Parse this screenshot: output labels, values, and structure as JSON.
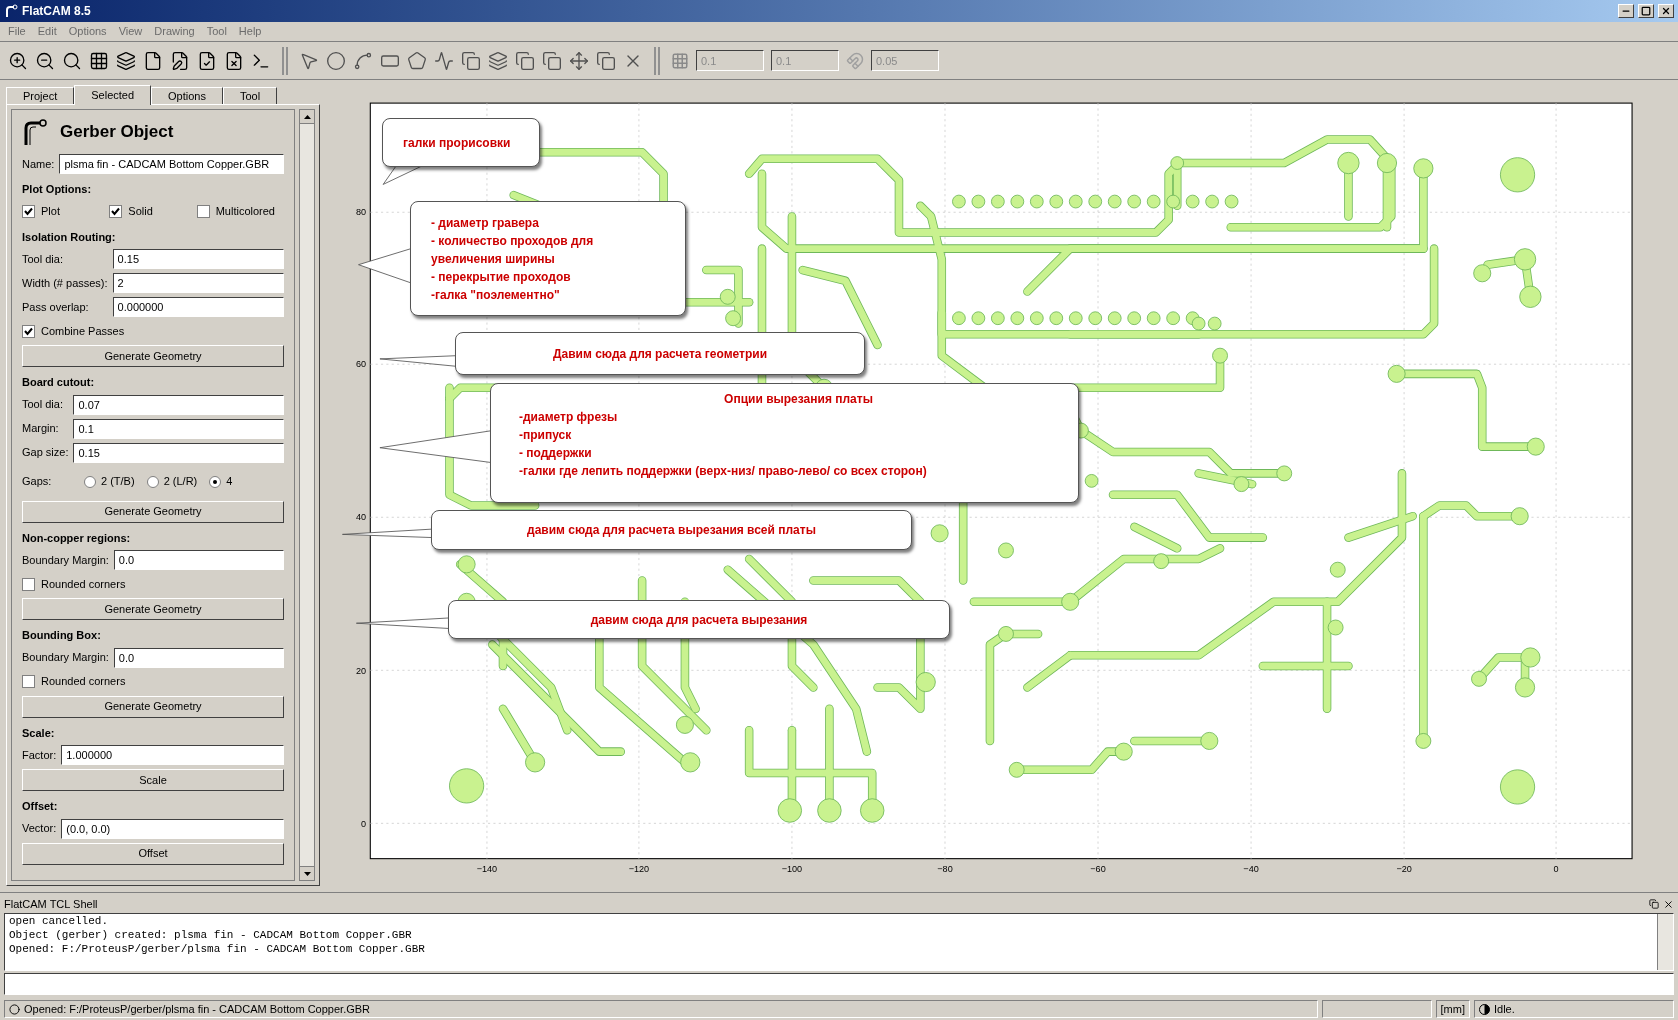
{
  "window": {
    "title": "FlatCAM 8.5"
  },
  "menu": [
    "File",
    "Edit",
    "Options",
    "View",
    "Drawing",
    "Tool",
    "Help"
  ],
  "toolbar_fields": [
    {
      "value": "0.1",
      "disabled": true
    },
    {
      "value": "0.1",
      "disabled": true
    },
    {
      "value": "0.05",
      "disabled": true
    }
  ],
  "tabs": [
    {
      "label": "Project",
      "selected": false
    },
    {
      "label": "Selected",
      "selected": true
    },
    {
      "label": "Options",
      "selected": false
    },
    {
      "label": "Tool",
      "selected": false
    }
  ],
  "panel": {
    "title": "Gerber Object",
    "sections": [
      {
        "items": [
          {
            "kind": "field",
            "label": "Name:",
            "value": "plsma fin - CADCAM Bottom Copper.GBR"
          }
        ]
      },
      {
        "heading": "Plot Options:",
        "items": [
          {
            "kind": "checkrow",
            "boxes": [
              {
                "label": "Plot",
                "checked": true
              },
              {
                "label": "Solid",
                "checked": true
              },
              {
                "label": "Multicolored",
                "checked": false
              }
            ]
          }
        ]
      },
      {
        "heading": "Isolation Routing:",
        "items": [
          {
            "kind": "field",
            "label": "Tool dia:",
            "value": "0.15"
          },
          {
            "kind": "field",
            "label": "Width (# passes):",
            "value": "2"
          },
          {
            "kind": "field",
            "label": "Pass overlap:",
            "value": "0.000000"
          },
          {
            "kind": "checkbox",
            "label": "Combine Passes",
            "checked": true
          },
          {
            "kind": "button",
            "label": "Generate Geometry"
          }
        ]
      },
      {
        "heading": "Board cutout:",
        "items": [
          {
            "kind": "field",
            "label": "Tool dia:",
            "value": "0.07"
          },
          {
            "kind": "field",
            "label": "Margin:",
            "value": "0.1"
          },
          {
            "kind": "field",
            "label": "Gap size:",
            "value": "0.15"
          },
          {
            "kind": "radios",
            "label": "Gaps:",
            "options": [
              {
                "label": "2 (T/B)",
                "selected": false
              },
              {
                "label": "2 (L/R)",
                "selected": false
              },
              {
                "label": "4",
                "selected": true
              }
            ]
          },
          {
            "kind": "button",
            "label": "Generate Geometry"
          }
        ]
      },
      {
        "heading": "Non-copper regions:",
        "items": [
          {
            "kind": "field",
            "label": "Boundary Margin:",
            "value": "0.0"
          },
          {
            "kind": "checkbox",
            "label": "Rounded corners",
            "checked": false
          },
          {
            "kind": "button",
            "label": "Generate Geometry"
          }
        ]
      },
      {
        "heading": "Bounding Box:",
        "items": [
          {
            "kind": "field",
            "label": "Boundary Margin:",
            "value": "0.0"
          },
          {
            "kind": "checkbox",
            "label": "Rounded corners",
            "checked": false
          },
          {
            "kind": "button",
            "label": "Generate Geometry"
          }
        ]
      },
      {
        "heading": "Scale:",
        "items": [
          {
            "kind": "field",
            "label": "Factor:",
            "value": "1.000000"
          },
          {
            "kind": "button",
            "label": "Scale"
          }
        ]
      },
      {
        "heading": "Offset:",
        "items": [
          {
            "kind": "field",
            "label": "Vector:",
            "value": "(0.0, 0.0)"
          },
          {
            "kind": "button",
            "label": "Offset"
          }
        ]
      }
    ]
  },
  "plot": {
    "xticks": [
      "−140",
      "−120",
      "−100",
      "−80",
      "−60",
      "−40",
      "−20",
      "0"
    ],
    "yticks": [
      "80",
      "60",
      "40",
      "20",
      "0"
    ]
  },
  "callouts": [
    {
      "kind": "plain",
      "lines": [
        "галки прорисовки"
      ]
    },
    {
      "kind": "plain",
      "lines": [
        "- диаметр гравера",
        "- количество проходов для",
        "увеличения ширины",
        "- перекрытие проходов",
        "-галка \"поэлементно\""
      ]
    },
    {
      "kind": "centered",
      "lines": [
        "Давим сюда для расчета геометрии"
      ]
    },
    {
      "kind": "titled",
      "title": "Опции вырезания платы",
      "lines": [
        "-диаметр фрезы",
        "-припуск",
        "- поддержки",
        "-галки где лепить поддержки (верх-низ/ право-лево/ со всех сторон)"
      ]
    },
    {
      "kind": "centered",
      "lines": [
        "давим сюда для расчета вырезания всей платы"
      ]
    },
    {
      "kind": "centered",
      "lines": [
        "давим сюда для расчета вырезания"
      ]
    }
  ],
  "shell": {
    "title": "FlatCAM TCL Shell",
    "lines": [
      "open cancelled.",
      "Object (gerber) created: plsma fin - CADCAM Bottom Copper.GBR",
      "Opened: F:/ProteusP/gerber/plsma fin - CADCAM Bottom Copper.GBR"
    ]
  },
  "status_bar": {
    "message": "Opened: F:/ProteusP/gerber/plsma fin - CADCAM Bottom Copper.GBR",
    "units": "[mm]",
    "state": "Idle."
  }
}
